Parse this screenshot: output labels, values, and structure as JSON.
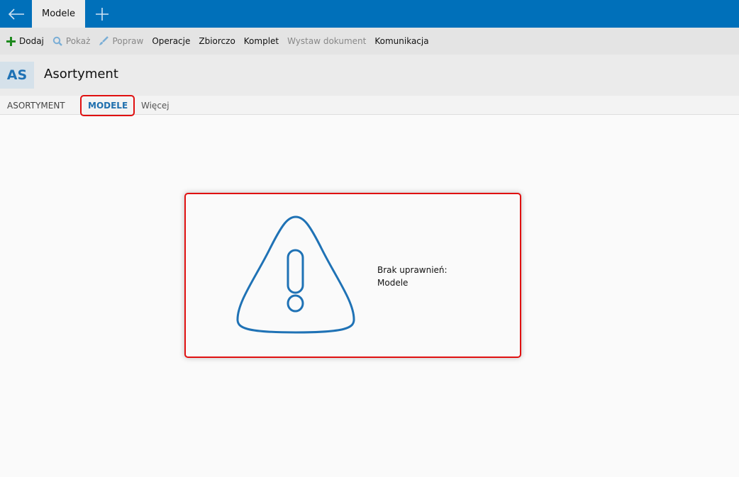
{
  "topbar": {
    "tab_label": "Modele",
    "back_icon": "arrow-left-icon",
    "add_icon": "plus-icon"
  },
  "toolbar": [
    {
      "label": "Dodaj",
      "icon": "plus-icon",
      "enabled": true
    },
    {
      "label": "Pokaż",
      "icon": "search-icon",
      "enabled": false
    },
    {
      "label": "Popraw",
      "icon": "brush-icon",
      "enabled": false
    },
    {
      "label": "Operacje",
      "enabled": true
    },
    {
      "label": "Zbiorczo",
      "enabled": true
    },
    {
      "label": "Komplet",
      "enabled": true
    },
    {
      "label": "Wystaw dokument",
      "enabled": false
    },
    {
      "label": "Komunikacja",
      "enabled": true
    }
  ],
  "header": {
    "badge": "AS",
    "title": "Asortyment"
  },
  "tabs": [
    {
      "label": "ASORTYMENT"
    },
    {
      "label": "MODELE",
      "active": true
    },
    {
      "label": "Więcej"
    }
  ],
  "message": {
    "line1": "Brak uprawnień:",
    "line2": "Modele",
    "icon": "warning-icon"
  },
  "colors": {
    "accent": "#0070ba",
    "highlight": "#e01010"
  }
}
